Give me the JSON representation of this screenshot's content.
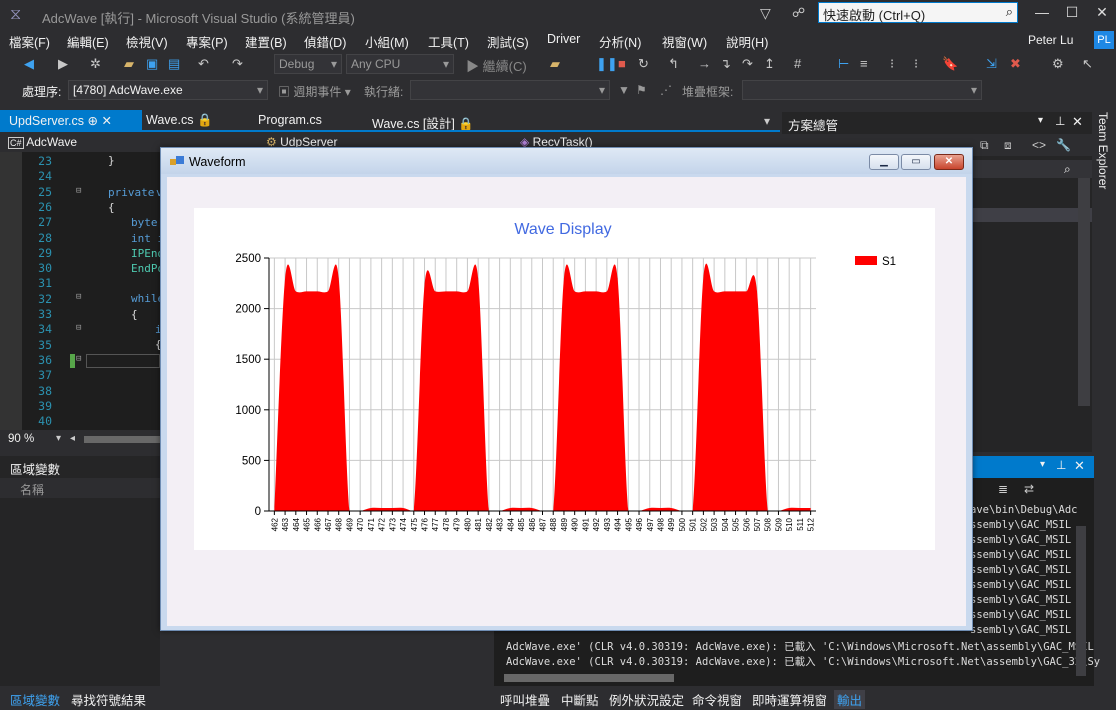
{
  "window": {
    "title": "AdcWave [執行] - Microsoft Visual Studio (系統管理員)",
    "quick_launch": "快速啟動 (Ctrl+Q)"
  },
  "menu": [
    "檔案(F)",
    "編輯(E)",
    "檢視(V)",
    "專案(P)",
    "建置(B)",
    "偵錯(D)",
    "小組(M)",
    "工具(T)",
    "測試(S)",
    "Driver",
    "分析(N)",
    "視窗(W)",
    "說明(H)"
  ],
  "user": {
    "name": "Peter Lu",
    "initials": "PL"
  },
  "toolbar": {
    "config": "Debug",
    "platform": "Any CPU",
    "continue": "繼續(C)"
  },
  "process_bar": {
    "label": "處理序:",
    "process": "[4780] AdcWave.exe",
    "lifecycle": "週期事件",
    "thread": "執行緒:",
    "stackframe": "堆疊框架:"
  },
  "doc_tabs": [
    "UpdServer.cs",
    "Wave.cs",
    "Program.cs",
    "Wave.cs [設計]"
  ],
  "editor": {
    "project": "AdcWave",
    "class": "UdpServer",
    "member": "RecvTask()",
    "zoom": "90 %",
    "lines": [
      "23",
      "24",
      "25",
      "26",
      "27",
      "28",
      "29",
      "30",
      "31",
      "32",
      "33",
      "34",
      "35",
      "36",
      "37",
      "38",
      "39",
      "40"
    ],
    "code": {
      "l23": "}",
      "l25a": "private",
      "l25b": "v",
      "l27": "byte[",
      "l28": "int i",
      "l29": "IPEnd",
      "l30": "EndPo",
      "l32": "while",
      "l33": "{",
      "l34": "i",
      "l35": "{"
    }
  },
  "solution_explorer": {
    "title": "方案總管"
  },
  "team_explorer": "Team Explorer",
  "locals": {
    "title": "區域變數",
    "column": "名稱"
  },
  "output": {
    "lines": [
      "ave\\bin\\Debug\\Adc",
      "ssembly\\GAC_MSIL",
      "ssembly\\GAC_MSIL",
      "ssembly\\GAC_MSIL",
      "ssembly\\GAC_MSIL",
      "ssembly\\GAC_MSIL",
      "ssembly\\GAC_MSIL",
      "ssembly\\GAC_MSIL",
      "ssembly\\GAC_MSIL",
      "AdcWave.exe' (CLR v4.0.30319: AdcWave.exe): 已載入 'C:\\Windows\\Microsoft.Net\\assembly\\GAC_MSIL",
      "AdcWave.exe' (CLR v4.0.30319: AdcWave.exe): 已載入 'C:\\Windows\\Microsoft.Net\\assembly\\GAC_32\\Sy"
    ]
  },
  "bottom_tabs_left": [
    "區域變數",
    "尋找符號結果"
  ],
  "bottom_tabs_right": [
    "呼叫堆疊",
    "中斷點",
    "例外狀況設定",
    "命令視窗",
    "即時運算視窗",
    "輸出"
  ],
  "waveform_window": {
    "title": "Waveform"
  },
  "colors": {
    "accent": "#007acc",
    "series": "#ff0000",
    "title": "#4169e1"
  },
  "chart_data": {
    "type": "area",
    "title": "Wave Display",
    "legend": "top-right",
    "grid": true,
    "ylim": [
      0,
      2500
    ],
    "yticks": [
      "0",
      "500",
      "1000",
      "1500",
      "2000",
      "2500"
    ],
    "x": [
      462,
      463,
      464,
      465,
      466,
      467,
      468,
      469,
      470,
      471,
      472,
      473,
      474,
      475,
      476,
      477,
      478,
      479,
      480,
      481,
      482,
      483,
      484,
      485,
      486,
      487,
      488,
      489,
      490,
      491,
      492,
      493,
      494,
      495,
      496,
      497,
      498,
      499,
      500,
      501,
      502,
      503,
      504,
      505,
      506,
      507,
      508,
      509,
      510,
      511,
      512
    ],
    "series": [
      {
        "name": "S1",
        "values": [
          0,
          2300,
          2170,
          2170,
          2170,
          2170,
          2300,
          0,
          0,
          30,
          30,
          30,
          30,
          0,
          2230,
          2170,
          2170,
          2170,
          2170,
          2300,
          0,
          0,
          30,
          30,
          30,
          0,
          0,
          2300,
          2170,
          2170,
          2170,
          2170,
          2300,
          0,
          0,
          30,
          30,
          30,
          0,
          0,
          2310,
          2170,
          2170,
          2170,
          2170,
          2170,
          0,
          0,
          30,
          30,
          30
        ]
      }
    ]
  }
}
